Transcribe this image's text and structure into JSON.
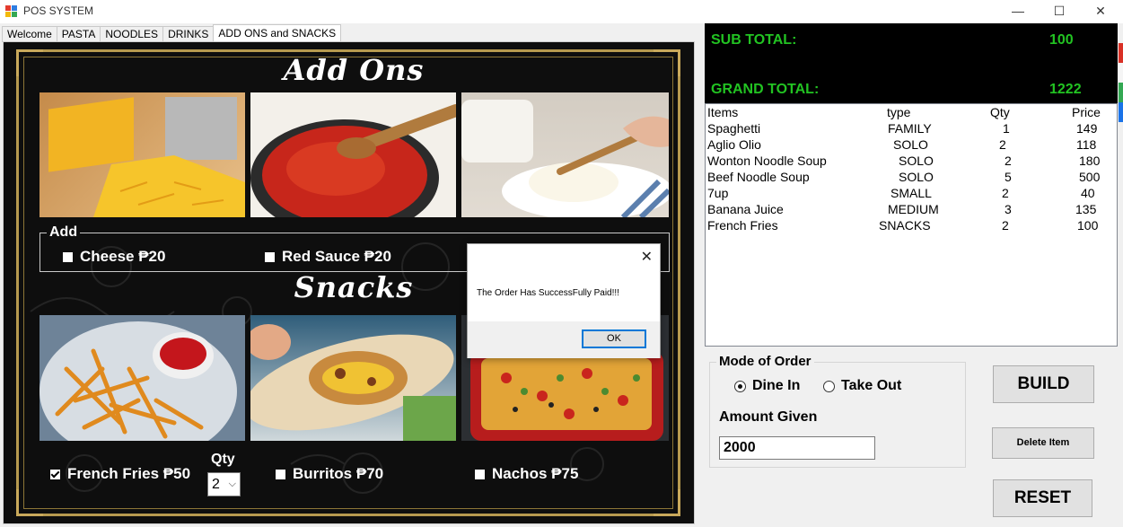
{
  "window": {
    "title": "POS SYSTEM",
    "minimize_glyph": "—",
    "maximize_glyph": "☐",
    "close_glyph": "✕"
  },
  "tabs": [
    {
      "label": "Welcome"
    },
    {
      "label": "PASTA"
    },
    {
      "label": "NOODLES"
    },
    {
      "label": "DRINKS"
    },
    {
      "label": "ADD ONS and SNACKS",
      "active": true
    }
  ],
  "addons": {
    "heading": "Add Ons",
    "group_label": "Add",
    "options": [
      {
        "label": "Cheese",
        "price": "₱20",
        "checked": false
      },
      {
        "label": "Red Sauce",
        "price": "₱20",
        "checked": false
      }
    ]
  },
  "snacks": {
    "heading": "Snacks",
    "qty_label": "Qty",
    "qty_value": "2",
    "options": [
      {
        "label": "French Fries",
        "price": "₱50",
        "checked": true
      },
      {
        "label": "Burritos",
        "price": "₱70",
        "checked": false
      },
      {
        "label": "Nachos",
        "price": "₱75",
        "checked": false
      }
    ]
  },
  "dialog": {
    "message": "The Order Has SuccessFully Paid!!!",
    "ok_label": "OK",
    "close_glyph": "✕"
  },
  "totals": {
    "sub_total_label": "SUB TOTAL:",
    "sub_total_value": "100",
    "grand_total_label": "GRAND TOTAL:",
    "grand_total_value": "1222",
    "color": "#22c322"
  },
  "order_list": {
    "columns": [
      "Items",
      "type",
      "Qty",
      "Price"
    ],
    "rows": [
      {
        "item": "Spaghetti",
        "type": "FAMILY",
        "qty": "1",
        "price": "149"
      },
      {
        "item": "Aglio Olio",
        "type": "SOLO",
        "qty": "2",
        "price": "118"
      },
      {
        "item": "Wonton Noodle Soup",
        "type": "SOLO",
        "qty": "2",
        "price": "180"
      },
      {
        "item": "Beef Noodle Soup",
        "type": "SOLO",
        "qty": "5",
        "price": "500"
      },
      {
        "item": "7up",
        "type": "SMALL",
        "qty": "2",
        "price": "40"
      },
      {
        "item": "Banana Juice",
        "type": "MEDIUM",
        "qty": "3",
        "price": "135"
      },
      {
        "item": "French Fries",
        "type": "SNACKS",
        "qty": "2",
        "price": "100"
      }
    ]
  },
  "order": {
    "mode_label": "Mode of Order",
    "dine_in_label": "Dine In",
    "take_out_label": "Take Out",
    "selected_mode": "Dine In",
    "amount_label": "Amount Given",
    "amount_value": "2000"
  },
  "buttons": {
    "build": "BUILD",
    "delete": "Delete Item",
    "reset": "RESET"
  }
}
